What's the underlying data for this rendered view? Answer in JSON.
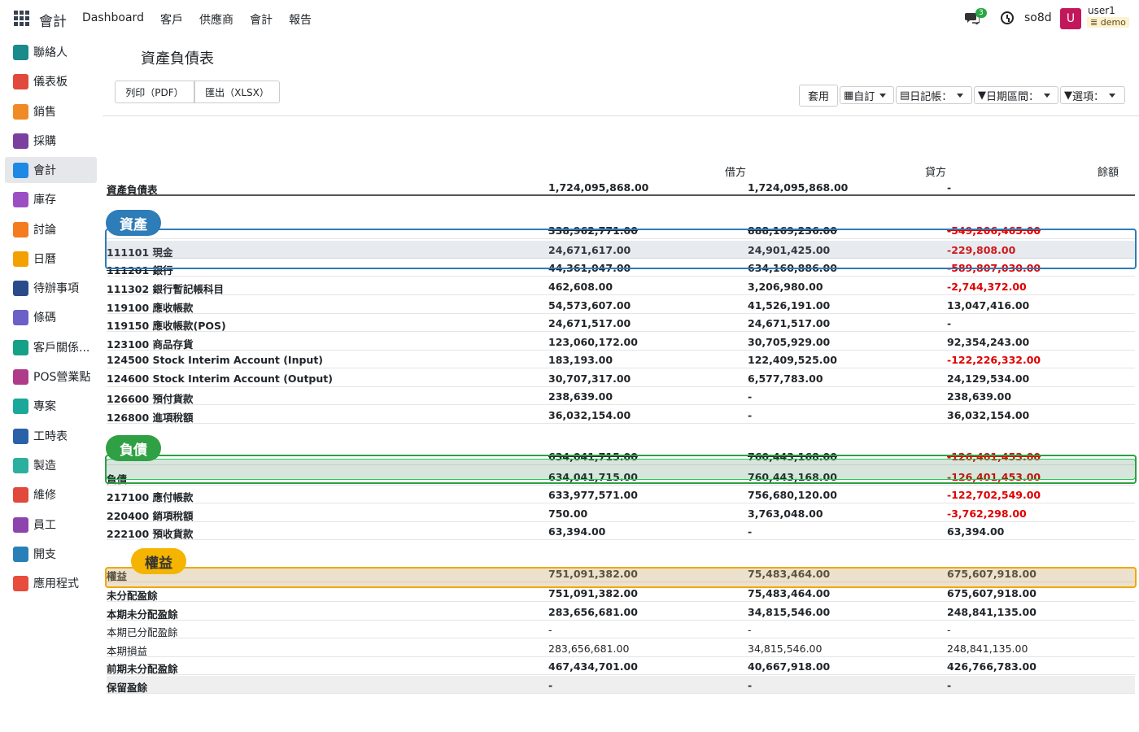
{
  "navbar": {
    "brand": "會計",
    "menu": [
      "Dashboard",
      "客戶",
      "供應商",
      "會計",
      "報告"
    ],
    "chat_badge": "3",
    "company": "so8d",
    "avatar_letter": "U",
    "user": "user1",
    "database": "demo"
  },
  "sidebar": {
    "items": [
      {
        "label": "聯絡人",
        "color": "#1a8a8a"
      },
      {
        "label": "儀表板",
        "color": "#e0493b"
      },
      {
        "label": "銷售",
        "color": "#f08a24"
      },
      {
        "label": "採購",
        "color": "#7b3fa0"
      },
      {
        "label": "會計",
        "color": "#1e88e5"
      },
      {
        "label": "庫存",
        "color": "#9c4fc2"
      },
      {
        "label": "討論",
        "color": "#f47b20"
      },
      {
        "label": "日曆",
        "color": "#f2a100"
      },
      {
        "label": "待辦事項",
        "color": "#2b4a8a"
      },
      {
        "label": "條碼",
        "color": "#6b5fc8"
      },
      {
        "label": "客戶關係...",
        "color": "#16a085"
      },
      {
        "label": "POS營業點",
        "color": "#b03a8a"
      },
      {
        "label": "專案",
        "color": "#1aa89a"
      },
      {
        "label": "工時表",
        "color": "#2962a8"
      },
      {
        "label": "製造",
        "color": "#2bb0a0"
      },
      {
        "label": "維修",
        "color": "#e0493b"
      },
      {
        "label": "員工",
        "color": "#8e44ad"
      },
      {
        "label": "開支",
        "color": "#2980b9"
      },
      {
        "label": "應用程式",
        "color": "#e74c3c"
      }
    ],
    "active_index": 4
  },
  "page": {
    "title": "資產負債表",
    "print_btn": "列印（PDF）",
    "export_btn": "匯出（XLSX）",
    "apply_btn": "套用",
    "filters": [
      "自訂",
      "日記帳：",
      "日期區間：",
      "選項："
    ]
  },
  "report": {
    "columns": [
      "借方",
      "貸方",
      "餘額"
    ],
    "rows": [
      {
        "name": "資產負債表",
        "v1": "1,724,095,868.00",
        "v2": "1,724,095,868.00",
        "v3": "-",
        "style": "total"
      },
      {
        "name": "",
        "v1": "338,962,771.00",
        "v2": "888,169,236.00",
        "v3": "-549,206,465.00",
        "style": "strike",
        "neg": true
      },
      {
        "name": "111101 現金",
        "v1": "24,671,617.00",
        "v2": "24,901,425.00",
        "v3": "-229,808.00",
        "style": "bold",
        "neg": true
      },
      {
        "name": "111201 銀行",
        "v1": "44,361,047.00",
        "v2": "634,160,886.00",
        "v3": "-589,807,030.00",
        "style": "strike",
        "neg": true
      },
      {
        "name": "111302 銀行暫記帳科目",
        "v1": "462,608.00",
        "v2": "3,206,980.00",
        "v3": "-2,744,372.00",
        "style": "bold",
        "neg": true
      },
      {
        "name": "119100 應收帳款",
        "v1": "54,573,607.00",
        "v2": "41,526,191.00",
        "v3": "13,047,416.00",
        "style": "bold"
      },
      {
        "name": "119150 應收帳款(POS)",
        "v1": "24,671,517.00",
        "v2": "24,671,517.00",
        "v3": "-",
        "style": "bold"
      },
      {
        "name": "123100 商品存貨",
        "v1": "123,060,172.00",
        "v2": "30,705,929.00",
        "v3": "92,354,243.00",
        "style": "bold"
      },
      {
        "name": "124500 Stock Interim Account (Input)",
        "v1": "183,193.00",
        "v2": "122,409,525.00",
        "v3": "-122,226,332.00",
        "style": "bold",
        "neg": true
      },
      {
        "name": "124600 Stock Interim Account (Output)",
        "v1": "30,707,317.00",
        "v2": "6,577,783.00",
        "v3": "24,129,534.00",
        "style": "bold"
      },
      {
        "name": "126600 預付貨款",
        "v1": "238,639.00",
        "v2": "-",
        "v3": "238,639.00",
        "style": "bold"
      },
      {
        "name": "126800 進項稅額",
        "v1": "36,032,154.00",
        "v2": "-",
        "v3": "36,032,154.00",
        "style": "bold"
      },
      {
        "name": "",
        "v1": "634,041,715.00",
        "v2": "760,443,168.00",
        "v3": "-126,401,453.00",
        "style": "strike",
        "neg": true
      },
      {
        "name": "負債",
        "v1": "634,041,715.00",
        "v2": "760,443,168.00",
        "v3": "-126,401,453.00",
        "style": "bold",
        "neg": true
      },
      {
        "name": "217100 應付帳款",
        "v1": "633,977,571.00",
        "v2": "756,680,120.00",
        "v3": "-122,702,549.00",
        "style": "bold",
        "neg": true
      },
      {
        "name": "220400 銷項稅額",
        "v1": "750.00",
        "v2": "3,763,048.00",
        "v3": "-3,762,298.00",
        "style": "bold",
        "neg": true
      },
      {
        "name": "222100 預收貨款",
        "v1": "63,394.00",
        "v2": "-",
        "v3": "63,394.00",
        "style": "bold"
      },
      {
        "name": "權益",
        "v1": "751,091,382.00",
        "v2": "75,483,464.00",
        "v3": "675,607,918.00",
        "style": "bold"
      },
      {
        "name": "未分配盈餘",
        "v1": "751,091,382.00",
        "v2": "75,483,464.00",
        "v3": "675,607,918.00",
        "style": "bold"
      },
      {
        "name": "本期未分配盈餘",
        "v1": "283,656,681.00",
        "v2": "34,815,546.00",
        "v3": "248,841,135.00",
        "style": "bold"
      },
      {
        "name": "本期已分配盈餘",
        "v1": "-",
        "v2": "-",
        "v3": "-",
        "style": "normal"
      },
      {
        "name": "本期損益",
        "v1": "283,656,681.00",
        "v2": "34,815,546.00",
        "v3": "248,841,135.00",
        "style": "normal"
      },
      {
        "name": "前期未分配盈餘",
        "v1": "467,434,701.00",
        "v2": "40,667,918.00",
        "v3": "426,766,783.00",
        "style": "bold"
      },
      {
        "name": "保留盈餘",
        "v1": "-",
        "v2": "-",
        "v3": "-",
        "style": "shaded"
      }
    ]
  },
  "annotations": {
    "assets": "資產",
    "liabilities": "負債",
    "equity": "權益"
  }
}
